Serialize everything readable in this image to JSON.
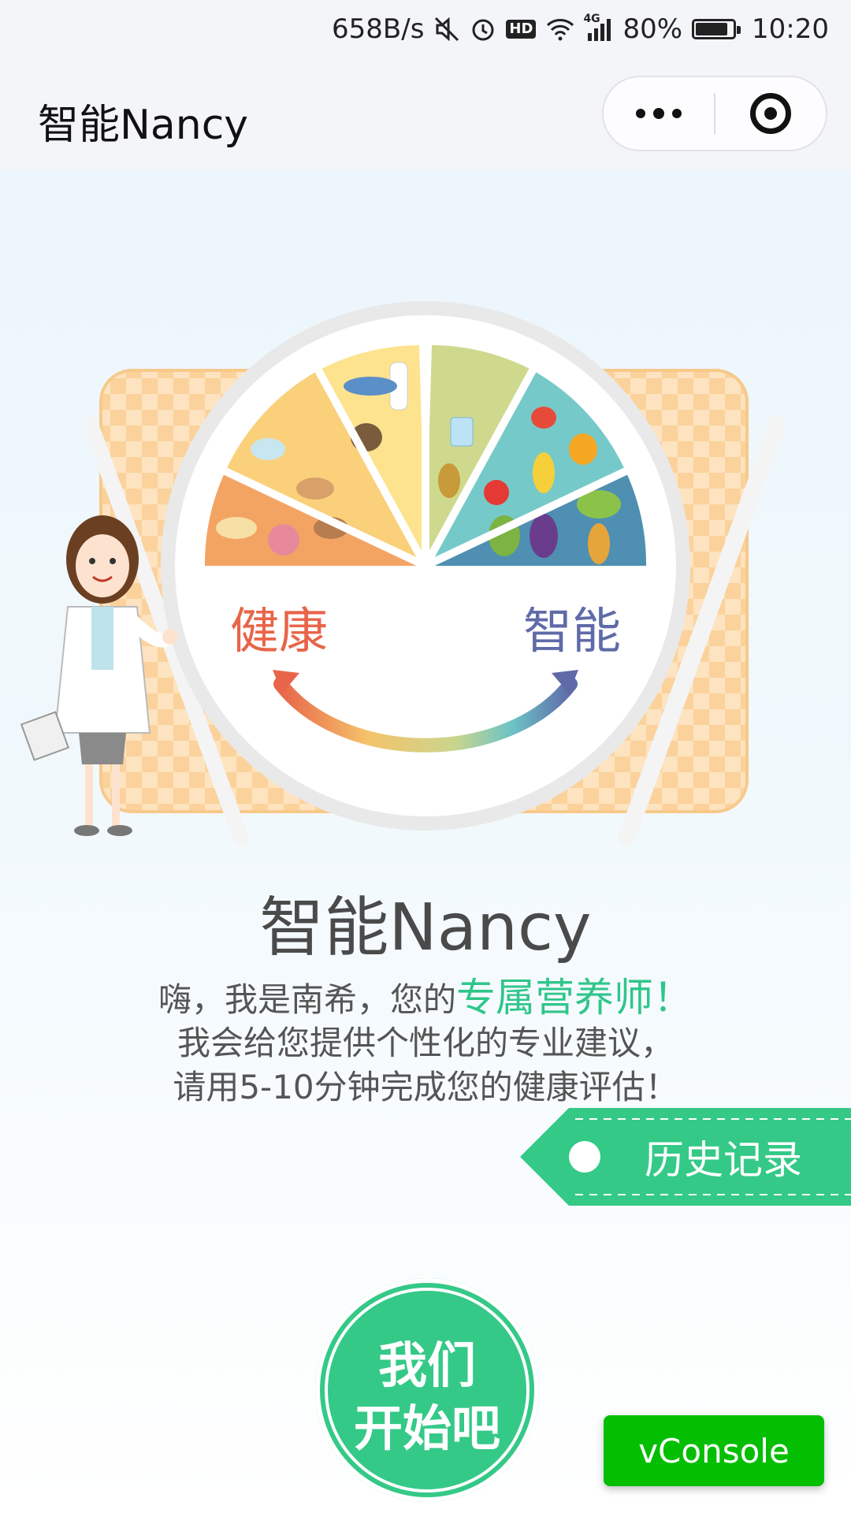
{
  "status_bar": {
    "net_speed": "658B/s",
    "hd": "HD",
    "network": "4G",
    "battery": "80%",
    "time": "10:20",
    "icons": [
      "mute-icon",
      "alarm-icon",
      "hd-icon",
      "wifi-icon",
      "signal-icon",
      "battery-icon"
    ]
  },
  "nav": {
    "title": "智能Nancy",
    "more_icon": "more-dots-icon",
    "close_icon": "target-icon"
  },
  "hero": {
    "left_label": "健康",
    "right_label": "智能"
  },
  "main": {
    "app_name": "智能Nancy",
    "intro_line1_prefix": "嗨，我是南希，您的",
    "intro_line1_highlight": "专属营养师！",
    "intro_line2": "我会给您提供个性化的专业建议，",
    "intro_line3": "请用5-10分钟完成您的健康评估！"
  },
  "history_button": {
    "label": "历史记录"
  },
  "start_button": {
    "line1": "我们",
    "line2": "开始吧"
  },
  "vconsole": {
    "label": "vConsole"
  },
  "colors": {
    "accent_green": "#2fc68a",
    "health_red": "#e8654a",
    "smart_blue": "#5f6aa8",
    "vconsole_green": "#04be02"
  }
}
